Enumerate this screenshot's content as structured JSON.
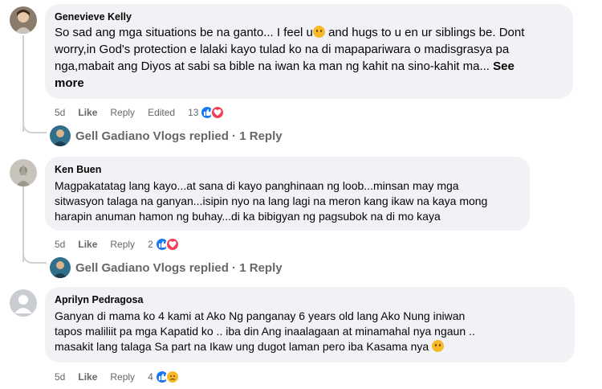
{
  "comments": [
    {
      "author": "Genevieve Kelly",
      "lines": [
        "So sad ang mga situations be na ganto... I feel u",
        "and hugs to u en ur siblings be. Dont",
        "worry,in God's protection e lalaki kayo tulad ko na di mapapariwara o madisgrasya pa",
        "nga,mabait ang Diyos at sabi sa bible na iwan ka man ng kahit na sino-kahit ma...",
        "more"
      ],
      "see_more_1": "See",
      "time": "5d",
      "like": "Like",
      "reply": "Reply",
      "edited": "Edited",
      "reaction_count": "13",
      "reactions": [
        "like-icon",
        "love-icon"
      ]
    },
    {
      "author": "Ken Buen",
      "lines": [
        "Magpakatatag lang kayo...at sana di kayo panghinaan ng loob...minsan may mga",
        "sitwasyon talaga na ganyan...isipin nyo na lang lagi na meron kang ikaw na kaya mong",
        "harapin anuman hamon ng buhay...di ka bibigyan ng pagsubok na di mo kaya"
      ],
      "time": "5d",
      "like": "Like",
      "reply": "Reply",
      "reaction_count": "2",
      "reactions": [
        "like-icon",
        "love-icon"
      ]
    },
    {
      "author": "Aprilyn Pedragosa",
      "lines": [
        "Ganyan di mama ko 4 kami at Ako Ng panganay 6 years old lang Ako Nung iniwan",
        "tapos maliliit pa mga Kapatid ko .. iba din Ang inaalagaan at minamahal nya ngaun ..",
        "masakit lang talaga Sa part na Ikaw ung dugot laman pero iba Kasama nya"
      ],
      "time": "5d",
      "like": "Like",
      "reply": "Reply",
      "reaction_count": "4",
      "reactions": [
        "like-icon",
        "sad-icon"
      ]
    }
  ],
  "replies": [
    {
      "name": "Gell Gadiano Vlogs replied",
      "sep": " · ",
      "count": "1 Reply"
    },
    {
      "name": "Gell Gadiano Vlogs replied",
      "sep": " · ",
      "count": "1 Reply"
    }
  ],
  "colors": {
    "bubble": "#f0f2f5",
    "meta_text": "#65676b",
    "like_blue": "#1877f2",
    "love_red": "#f33e58",
    "emoji_yellow": "#f7b928"
  }
}
